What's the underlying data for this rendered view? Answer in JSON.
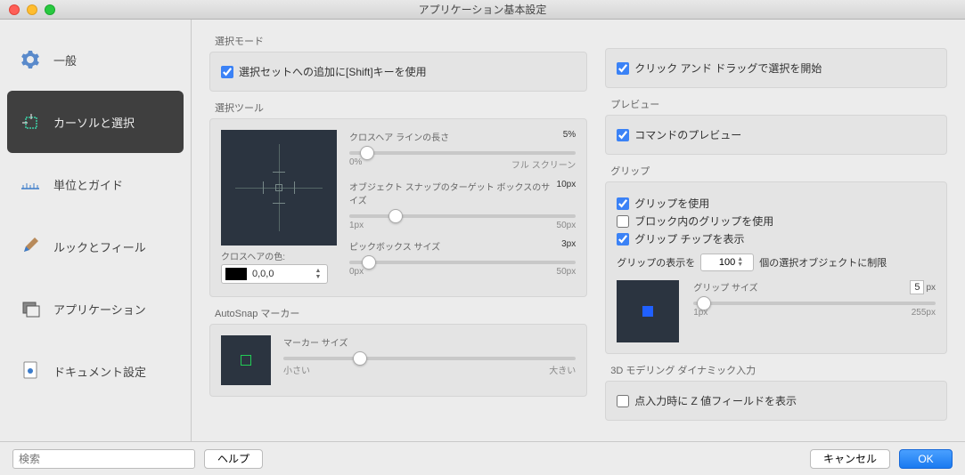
{
  "title": "アプリケーション基本設定",
  "sidebar": {
    "items": [
      {
        "label": "一般"
      },
      {
        "label": "カーソルと選択"
      },
      {
        "label": "単位とガイド"
      },
      {
        "label": "ルックとフィール"
      },
      {
        "label": "アプリケーション"
      },
      {
        "label": "ドキュメント設定"
      }
    ]
  },
  "selection_mode": {
    "section": "選択モード",
    "shift_add": "選択セットへの追加に[Shift]キーを使用",
    "click_drag": "クリック アンド ドラッグで選択を開始"
  },
  "selection_tool": {
    "section": "選択ツール",
    "crosshair_len": {
      "label": "クロスヘア ラインの長さ",
      "value": "5%",
      "min": "0%",
      "max": "フル スクリーン"
    },
    "snap_target": {
      "label": "オブジェクト スナップのターゲット ボックスのサイズ",
      "value": "10px",
      "min": "1px",
      "max": "50px"
    },
    "pickbox": {
      "label": "ピックボックス サイズ",
      "value": "3px",
      "min": "0px",
      "max": "50px"
    },
    "color_label": "クロスヘアの色:",
    "color_value": "0,0,0"
  },
  "autosnap": {
    "section": "AutoSnap マーカー",
    "marker": {
      "label": "マーカー サイズ",
      "min": "小さい",
      "max": "大きい"
    }
  },
  "preview": {
    "section": "プレビュー",
    "command": "コマンドのプレビュー"
  },
  "grip": {
    "section": "グリップ",
    "use": "グリップを使用",
    "block": "ブロック内のグリップを使用",
    "tips": "グリップ チップを表示",
    "limit_pre": "グリップの表示を",
    "limit_val": "100",
    "limit_post": "個の選択オブジェクトに制限",
    "size_label": "グリップ サイズ",
    "size_val": "5",
    "size_unit": "px",
    "size_min": "1px",
    "size_max": "255px"
  },
  "dyn3d": {
    "section": "3D モデリング ダイナミック入力",
    "z_field": "点入力時に Z 値フィールドを表示"
  },
  "footer": {
    "search_placeholder": "検索",
    "help": "ヘルプ",
    "cancel": "キャンセル",
    "ok": "OK"
  }
}
